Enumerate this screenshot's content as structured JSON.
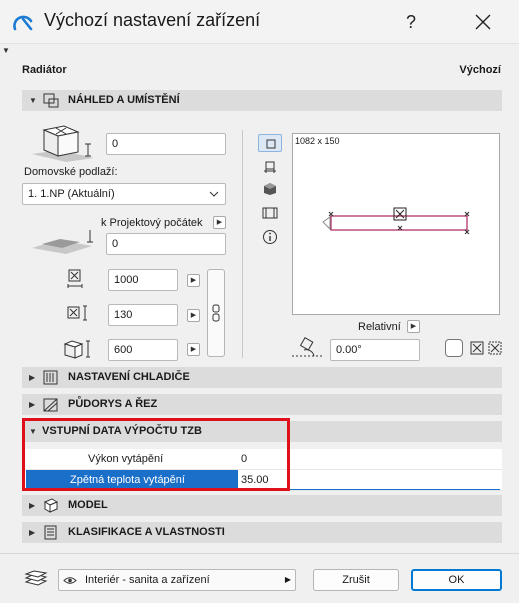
{
  "window": {
    "title": "Výchozí nastavení zařízení",
    "help_label": "?",
    "element_name": "Radiátor",
    "preset_name": "Výchozí"
  },
  "sections": {
    "preview": "NÁHLED A UMÍSTĚNÍ",
    "radiator": "NASTAVENÍ CHLADIČE",
    "floorplan": "PŮDORYS A ŘEZ",
    "tzb": "VSTUPNÍ DATA VÝPOČTU TZB",
    "model": "MODEL",
    "classification": "KLASIFIKACE A VLASTNOSTI"
  },
  "placement": {
    "top_offset": "0",
    "home_story_label": "Domovské podlaží:",
    "home_story_value": "1. 1.NP (Aktuální)",
    "reference_label": "k Projektový počátek",
    "base_offset": "0",
    "width": "1000",
    "depth": "130",
    "height": "600",
    "preview_dims": "1082 x 150",
    "relative_label": "Relativní",
    "angle": "0.00°"
  },
  "tzb_table": {
    "rows": [
      {
        "label": "Výkon vytápění",
        "value": "0"
      },
      {
        "label": "Zpětná teplota vytápění",
        "value": "35.00"
      }
    ]
  },
  "footer": {
    "layer_value": "Interiér - sanita a zařízení",
    "cancel_label": "Zrušit",
    "ok_label": "OK"
  },
  "colors": {
    "accent_blue": "#0078d4",
    "selection_blue": "#1a6fc9",
    "highlight_red": "#e0101a",
    "preview_line": "#b0326a"
  }
}
